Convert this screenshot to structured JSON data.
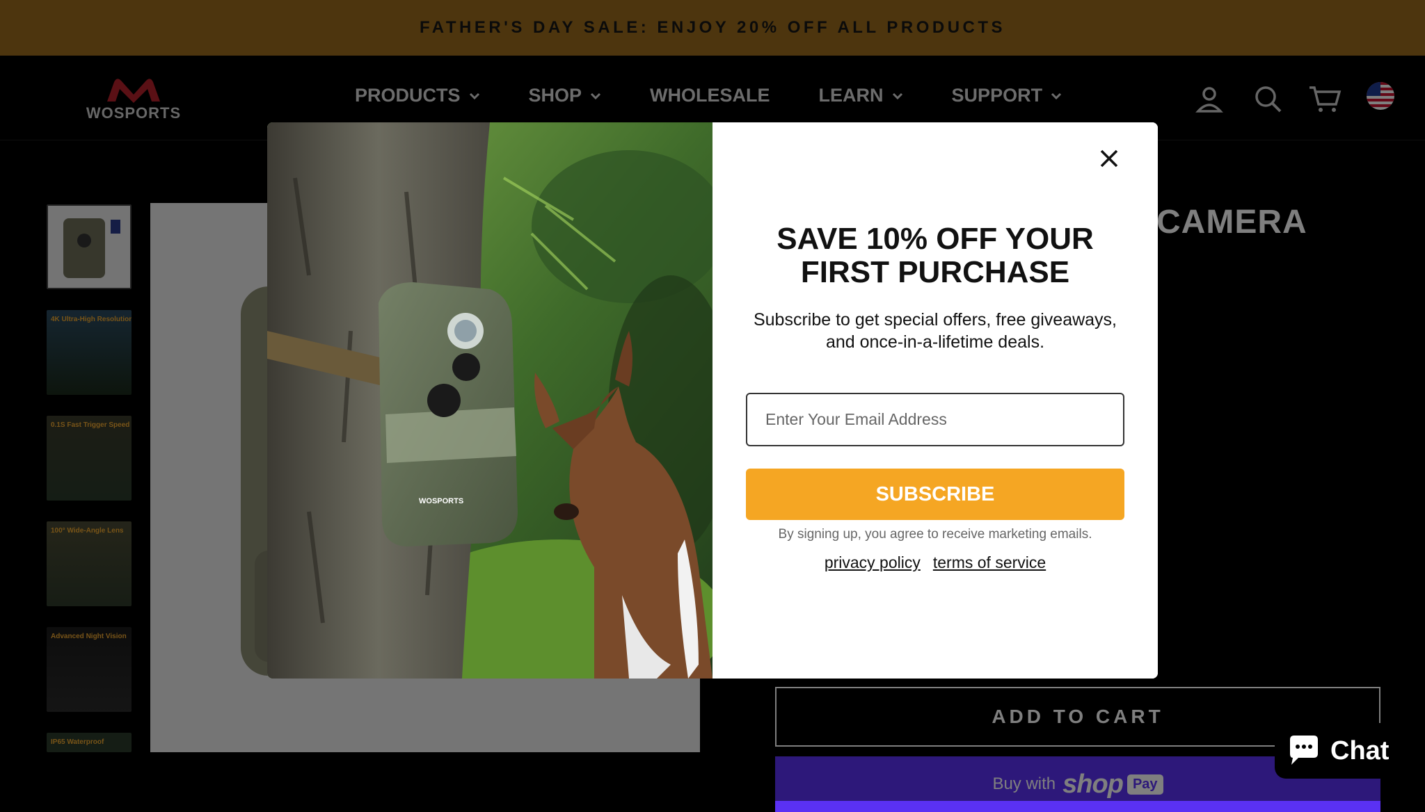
{
  "promo": {
    "text": "FATHER'S DAY SALE: ENJOY 20% OFF ALL PRODUCTS"
  },
  "header": {
    "logo_text": "WOSPORTS",
    "nav": [
      {
        "label": "PRODUCTS"
      },
      {
        "label": "SHOP"
      },
      {
        "label": "WHOLESALE"
      },
      {
        "label": "LEARN"
      },
      {
        "label": "SUPPORT"
      }
    ],
    "icons": [
      "account-icon",
      "search-icon",
      "cart-icon",
      "us-flag-icon"
    ]
  },
  "product": {
    "title_partial": "CAMERA",
    "thumbnail_labels": [
      "",
      "4K Ultra-High Resolution",
      "0.1S Fast Trigger Speed",
      "100° Wide-Angle Lens",
      "Advanced Night Vision",
      "IP65 Waterproof"
    ],
    "add_to_cart": "ADD TO CART",
    "shop_pay": {
      "buy_with": "Buy with",
      "shop": "shop",
      "pay": "Pay"
    }
  },
  "modal": {
    "heading_line1": "SAVE 10% OFF YOUR",
    "heading_line2": "FIRST PURCHASE",
    "subtitle_line1": "Subscribe to get special offers, free giveaways,",
    "subtitle_line2": "and once-in-a-lifetime deals.",
    "email_placeholder": "Enter Your Email Address",
    "subscribe_label": "SUBSCRIBE",
    "disclaimer": "By signing up, you agree to receive marketing emails.",
    "privacy_label": "privacy policy",
    "terms_label": "terms of service",
    "camera_brand": "WOSPORTS"
  },
  "chat": {
    "label": "Chat"
  },
  "colors": {
    "promo_bg": "#9a6a1c",
    "subscribe_bg": "#f5a623",
    "shop_pay_bg": "#5a31f4"
  }
}
